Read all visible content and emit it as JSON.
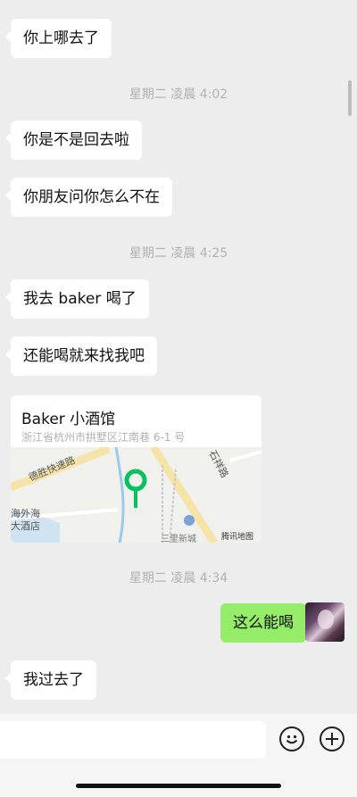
{
  "messages": [
    {
      "type": "text",
      "from": "other",
      "text": "你上哪去了"
    },
    {
      "type": "time",
      "text": "星期二 凌晨 4:02"
    },
    {
      "type": "text",
      "from": "other",
      "text": "你是不是回去啦"
    },
    {
      "type": "text",
      "from": "other",
      "text": "你朋友问你怎么不在"
    },
    {
      "type": "time",
      "text": "星期二 凌晨 4:25"
    },
    {
      "type": "text",
      "from": "other",
      "text": "我去 baker 喝了"
    },
    {
      "type": "text",
      "from": "other",
      "text": "还能喝就来找我吧"
    },
    {
      "type": "location",
      "from": "other",
      "name": "Baker 小酒馆",
      "address": "浙江省杭州市拱墅区江南巷 6-1 号"
    },
    {
      "type": "time",
      "text": "星期二 凌晨 4:34"
    },
    {
      "type": "text",
      "from": "me",
      "text": "这么能喝"
    },
    {
      "type": "text",
      "from": "other",
      "text": "我过去了"
    }
  ],
  "map": {
    "labels": [
      "德胜快速路",
      "石祥路",
      "海外海",
      "大酒店",
      "腾讯地图",
      "三里新城"
    ],
    "pin_color": "#07c160"
  },
  "input_bar": {
    "emoji_icon": "emoji-face-icon",
    "plus_icon": "plus-circle-icon"
  },
  "colors": {
    "background": "#ededed",
    "other_bubble": "#ffffff",
    "my_bubble": "#95ec69",
    "timestamp": "#b0b0b0"
  }
}
